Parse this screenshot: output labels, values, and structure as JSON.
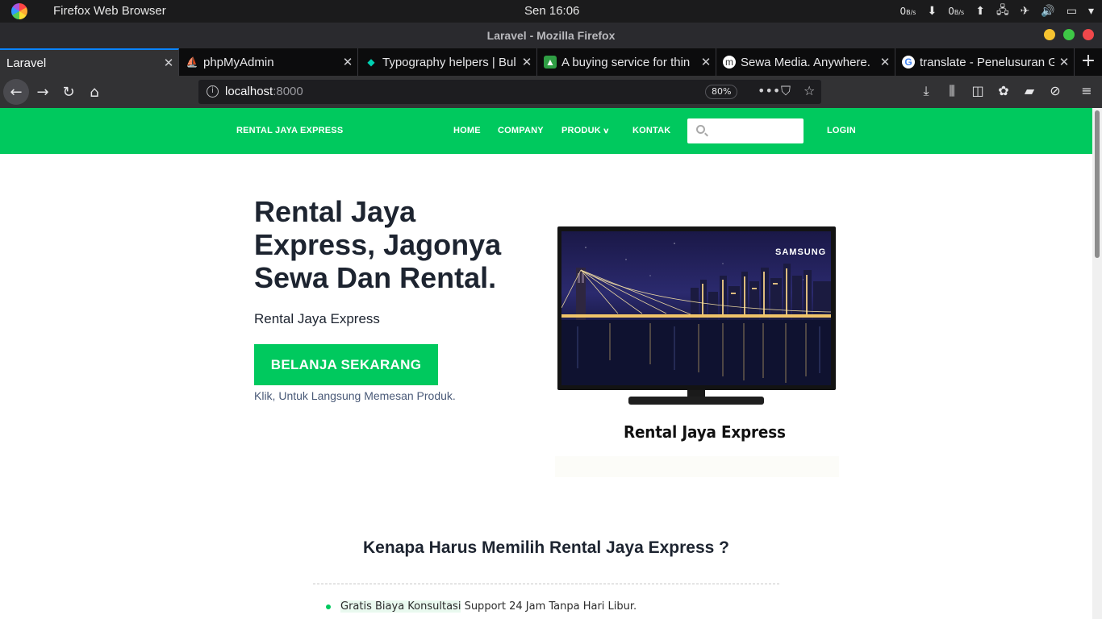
{
  "os_bar": {
    "app_name": "Firefox Web Browser",
    "clock": "Sen 16:06",
    "down_value": "0",
    "down_unit": "B/s",
    "up_value": "0",
    "up_unit": "B/s"
  },
  "window": {
    "title": "Laravel - Mozilla Firefox"
  },
  "tabs": [
    {
      "label": "Laravel",
      "active": true
    },
    {
      "label": "phpMyAdmin",
      "active": false
    },
    {
      "label": "Typography helpers | Bul",
      "active": false
    },
    {
      "label": "A buying service for thin",
      "active": false
    },
    {
      "label": "Sewa Media. Anywhere.",
      "active": false
    },
    {
      "label": "translate - Penelusuran G",
      "active": false
    }
  ],
  "urlbar": {
    "host": "localhost",
    "port": ":8000",
    "zoom": "80%"
  },
  "site": {
    "brand": "RENTAL JAYA EXPRESS",
    "nav": {
      "home": "HOME",
      "company": "COMPANY",
      "produk": "PRODUK",
      "kontak": "KONTAK",
      "login": "LOGIN"
    },
    "search_placeholder": "",
    "hero": {
      "title_bold": "Rental Jaya Express",
      "title_rest": ", Jagonya Sewa Dan Rental.",
      "subtitle": "Rental Jaya Express",
      "button": "BELANJA SEKARANG",
      "hint": "Klik, Untuk Langsung Memesan Produk."
    },
    "tv": {
      "brand": "SAMSUNG",
      "caption": "Rental Jaya Express"
    },
    "why": {
      "title": "Kenapa Harus Memilih Rental Jaya Express ?",
      "items": [
        {
          "highlight": "Gratis Biaya Konsultasi",
          "rest": " Support 24 Jam Tanpa Hari Libur."
        }
      ]
    }
  },
  "colors": {
    "brand_green": "#00c95e",
    "firefox_dark": "#323234",
    "tab_accent": "#0a84ff"
  }
}
